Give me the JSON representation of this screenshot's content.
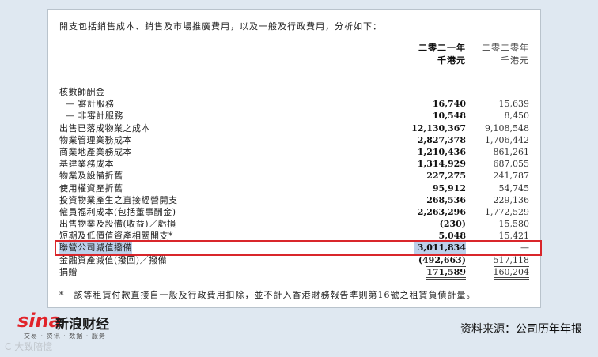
{
  "intro": "開支包括銷售成本、銷售及市場推廣費用，以及一般及行政費用，分析如下：",
  "columns": [
    {
      "year": "二零二一年",
      "unit": "千港元"
    },
    {
      "year": "二零二零年",
      "unit": "千港元"
    }
  ],
  "rows": [
    {
      "label": "核數師酬金",
      "v1": "",
      "v2": "",
      "indent": false
    },
    {
      "label": "— 審計服務",
      "v1": "16,740",
      "v2": "15,639",
      "indent": true
    },
    {
      "label": "— 非審計服務",
      "v1": "10,548",
      "v2": "8,450",
      "indent": true
    },
    {
      "label": "出售已落成物業之成本",
      "v1": "12,130,367",
      "v2": "9,108,548"
    },
    {
      "label": "物業管理業務成本",
      "v1": "2,827,378",
      "v2": "1,706,442"
    },
    {
      "label": "商業地產業務成本",
      "v1": "1,210,436",
      "v2": "861,261"
    },
    {
      "label": "基建業務成本",
      "v1": "1,314,929",
      "v2": "687,055"
    },
    {
      "label": "物業及設備折舊",
      "v1": "227,275",
      "v2": "241,787"
    },
    {
      "label": "使用權資產折舊",
      "v1": "95,912",
      "v2": "54,745"
    },
    {
      "label": "投資物業產生之直接經營開支",
      "v1": "268,536",
      "v2": "229,136"
    },
    {
      "label": "僱員福利成本(包括董事酬金)",
      "v1": "2,263,296",
      "v2": "1,772,529"
    },
    {
      "label": "出售物業及設備(收益)／虧損",
      "v1": "(230)",
      "v2": "15,580"
    },
    {
      "label": "短期及低價值資產相關開支*",
      "v1": "5,048",
      "v2": "15,421"
    },
    {
      "label": "聯營公司減值撥備",
      "v1": "3,011,834",
      "v2": "—",
      "highlight": true
    },
    {
      "label": "金融資產減值(撥回)／撥備",
      "v1": "(492,663)",
      "v2": "517,118"
    },
    {
      "label": "捐贈",
      "v1": "171,589",
      "v2": "160,204",
      "total": true
    }
  ],
  "footnote": "*　該等租賃付款直接自一般及行政費用扣除，並不計入香港財務報告準則第16號之租賃負債計量。",
  "logo": {
    "sina": "sina",
    "brand": "新浪财经",
    "slogan": "交易 · 资讯 · 数据 · 服务"
  },
  "watermark": "C 大致陪憶",
  "source": "资料来源：公司历年年报",
  "colors": {
    "highlight_box": "#d9262b",
    "highlight_fill": "#bcd0ea",
    "sina_red": "#e1232a"
  }
}
